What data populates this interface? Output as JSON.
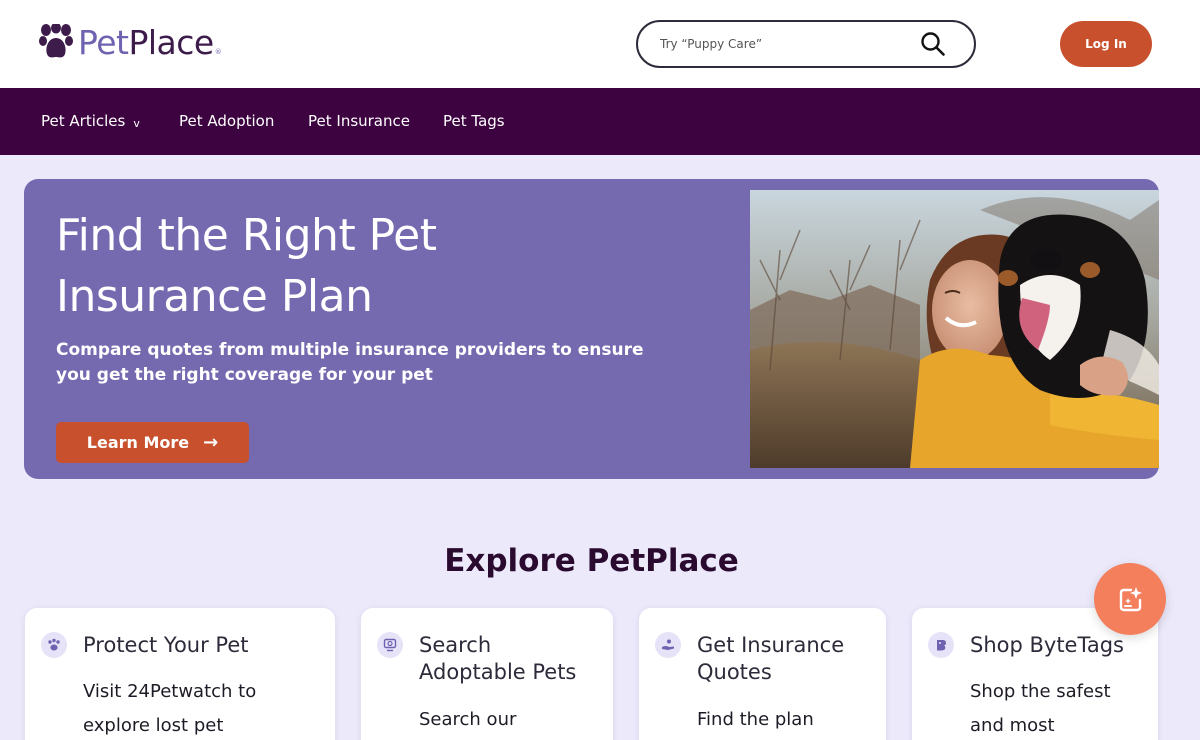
{
  "header": {
    "logo_part1": "Pet",
    "logo_part2": "Place",
    "logo_reg": "®",
    "search_placeholder": "Try “Puppy Care”",
    "login_label": "Log In"
  },
  "nav": {
    "items": [
      {
        "label": "Pet Articles",
        "has_dropdown": true,
        "dropdown_glyph": "v"
      },
      {
        "label": "Pet Adoption"
      },
      {
        "label": "Pet Insurance"
      },
      {
        "label": "Pet Tags"
      }
    ]
  },
  "hero": {
    "title": "Find the Right Pet Insurance Plan",
    "subtitle": "Compare quotes from multiple insurance providers to ensure you get the right coverage for your pet",
    "button_label": "Learn More",
    "button_icon": "arrow-right-icon",
    "image_alt": "Woman hugging a Bernese mountain dog outdoors"
  },
  "explore": {
    "title": "Explore PetPlace",
    "cards": [
      {
        "icon": "paw-icon",
        "title": "Protect Your Pet",
        "body": "Visit 24Petwatch to explore lost pet"
      },
      {
        "icon": "adopt-search-icon",
        "title": "Search Adoptable Pets",
        "body": "Search our"
      },
      {
        "icon": "insurance-hand-icon",
        "title": "Get Insurance Quotes",
        "body": "Find the plan"
      },
      {
        "icon": "bytetag-icon",
        "title": "Shop ByteTags",
        "body": "Shop the safest and most"
      }
    ]
  },
  "fab": {
    "icon": "ai-sparkle-chat-icon"
  },
  "colors": {
    "nav_bg": "#3d0340",
    "hero_bg": "#7569b0",
    "accent": "#c8502d",
    "page_bg": "#ece9fb",
    "fab_bg": "#f47f5d"
  }
}
